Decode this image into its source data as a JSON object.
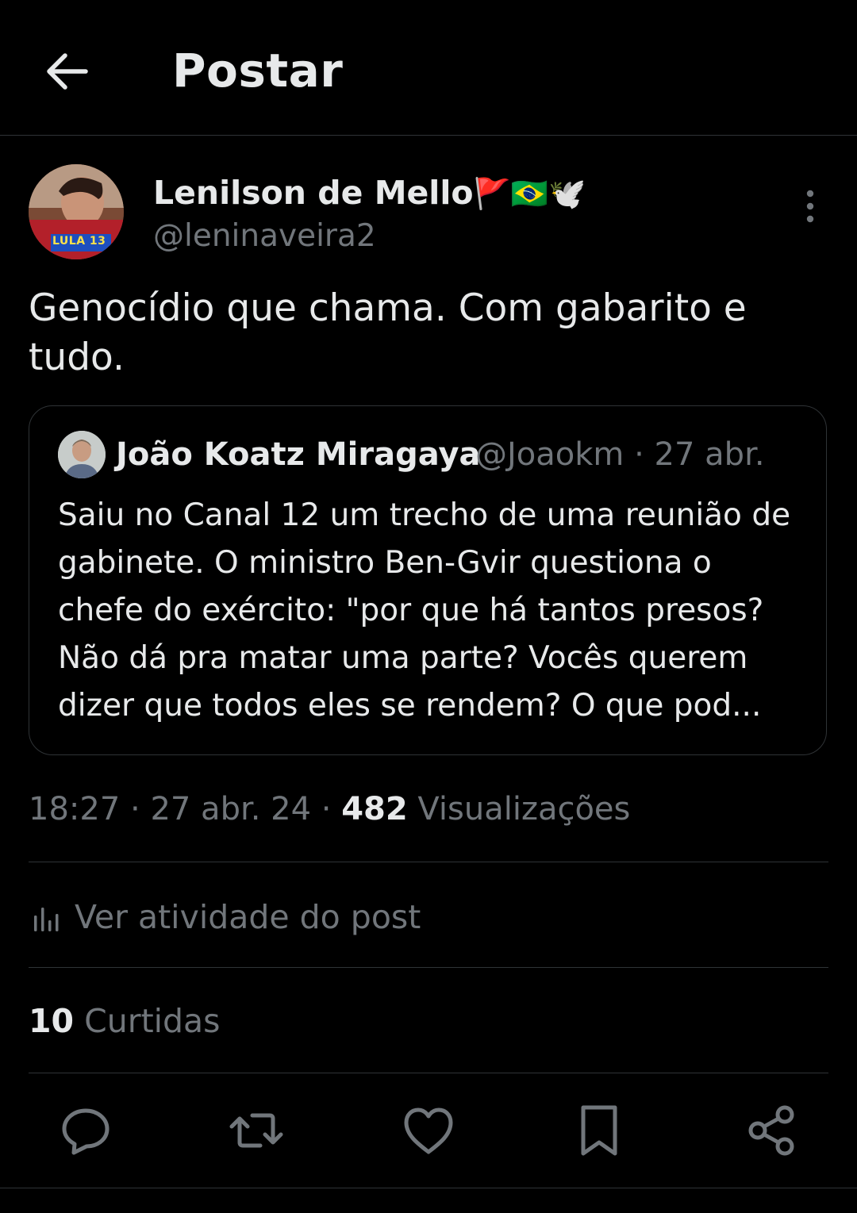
{
  "header": {
    "title": "Postar"
  },
  "post": {
    "author_name": "Lenilson de Mello",
    "author_flags": "🚩🇧🇷🕊️",
    "author_handle": "@leninaveira2",
    "avatar_badge_text": "LULA 13",
    "text": "Genocídio que chama. Com gabarito e tudo."
  },
  "quote": {
    "author_name": "João Koatz Miragaya",
    "author_handle": "@Joaokm",
    "separator": "·",
    "date": "27 abr.",
    "text": "Saiu no Canal 12 um trecho de uma reunião de gabinete. O ministro Ben-Gvir questiona o chefe do exército: \"por que há tantos presos? Não dá pra matar uma parte? Vocês querem dizer que todos eles se rendem? O que pod..."
  },
  "meta": {
    "time": "18:27",
    "sep1": " · ",
    "date": "27 abr. 24",
    "sep2": " · ",
    "views_count": "482",
    "views_label": " Visualizações"
  },
  "activity": {
    "label": "Ver atividade do post"
  },
  "likes": {
    "count": "10",
    "label": " Curtidas"
  },
  "actions": [
    "reply-icon",
    "repost-icon",
    "like-icon",
    "bookmark-icon",
    "share-icon"
  ],
  "colors": {
    "background": "#000000",
    "text": "#e7e9ea",
    "secondary": "#71767b",
    "border": "#2f3336"
  }
}
